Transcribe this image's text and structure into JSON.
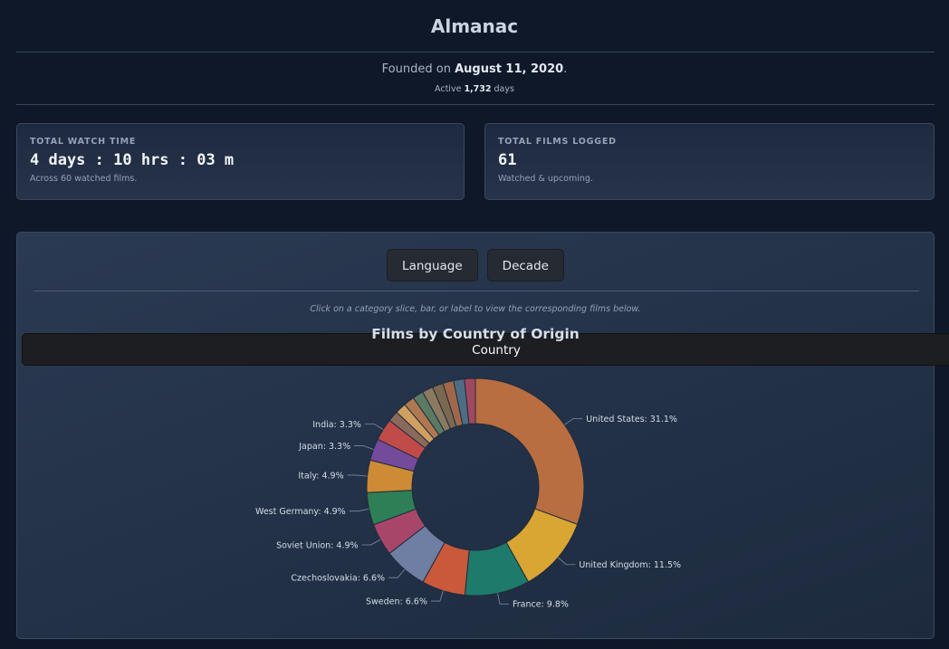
{
  "header": {
    "title": "Almanac",
    "founded_prefix": "Founded on ",
    "founded_date": "August 11, 2020",
    "founded_suffix": ".",
    "active_prefix": "Active ",
    "active_days": "1,732",
    "active_suffix": " days"
  },
  "stats": [
    {
      "label": "TOTAL WATCH TIME",
      "value": "4 days : 10 hrs : 03 m",
      "sub": "Across 60 watched films."
    },
    {
      "label": "TOTAL FILMS LOGGED",
      "value": "61",
      "sub": "Watched & upcoming."
    }
  ],
  "tabs": {
    "country": "Country",
    "language": "Language",
    "decade": "Decade",
    "active": "Country"
  },
  "hint": "Click on a category slice, bar, or label to view the corresponding films below.",
  "chart_data": {
    "type": "pie",
    "donut": true,
    "title": "Films by Country of Origin",
    "slices": [
      {
        "name": "United States",
        "value": 31.1,
        "label": "United States: 31.1%",
        "color": "#b86e40"
      },
      {
        "name": "United Kingdom",
        "value": 11.5,
        "label": "United Kingdom: 11.5%",
        "color": "#d9a533"
      },
      {
        "name": "France",
        "value": 9.8,
        "label": "France: 9.8%",
        "color": "#1e7a6a"
      },
      {
        "name": "Sweden",
        "value": 6.6,
        "label": "Sweden: 6.6%",
        "color": "#c9593a"
      },
      {
        "name": "Czechoslovakia",
        "value": 6.6,
        "label": "Czechoslovakia: 6.6%",
        "color": "#6e7fa3"
      },
      {
        "name": "Soviet Union",
        "value": 4.9,
        "label": "Soviet Union: 4.9%",
        "color": "#a8466a"
      },
      {
        "name": "West Germany",
        "value": 4.9,
        "label": "West Germany: 4.9%",
        "color": "#2e7f55"
      },
      {
        "name": "Italy",
        "value": 4.9,
        "label": "Italy: 4.9%",
        "color": "#cd8b35"
      },
      {
        "name": "Japan",
        "value": 3.3,
        "label": "Japan: 3.3%",
        "color": "#744a9b"
      },
      {
        "name": "India",
        "value": 3.3,
        "label": "India: 3.3%",
        "color": "#c14b48"
      },
      {
        "value": 1.64,
        "color": "#8a6a5a"
      },
      {
        "value": 1.64,
        "color": "#d0a060"
      },
      {
        "value": 1.64,
        "color": "#b07850"
      },
      {
        "value": 1.64,
        "color": "#5a7a64"
      },
      {
        "value": 1.64,
        "color": "#8a7a60"
      },
      {
        "value": 1.64,
        "color": "#7a6850"
      },
      {
        "value": 1.64,
        "color": "#a06848"
      },
      {
        "value": 1.64,
        "color": "#4e6c84"
      },
      {
        "value": 1.64,
        "color": "#a04860"
      }
    ]
  }
}
